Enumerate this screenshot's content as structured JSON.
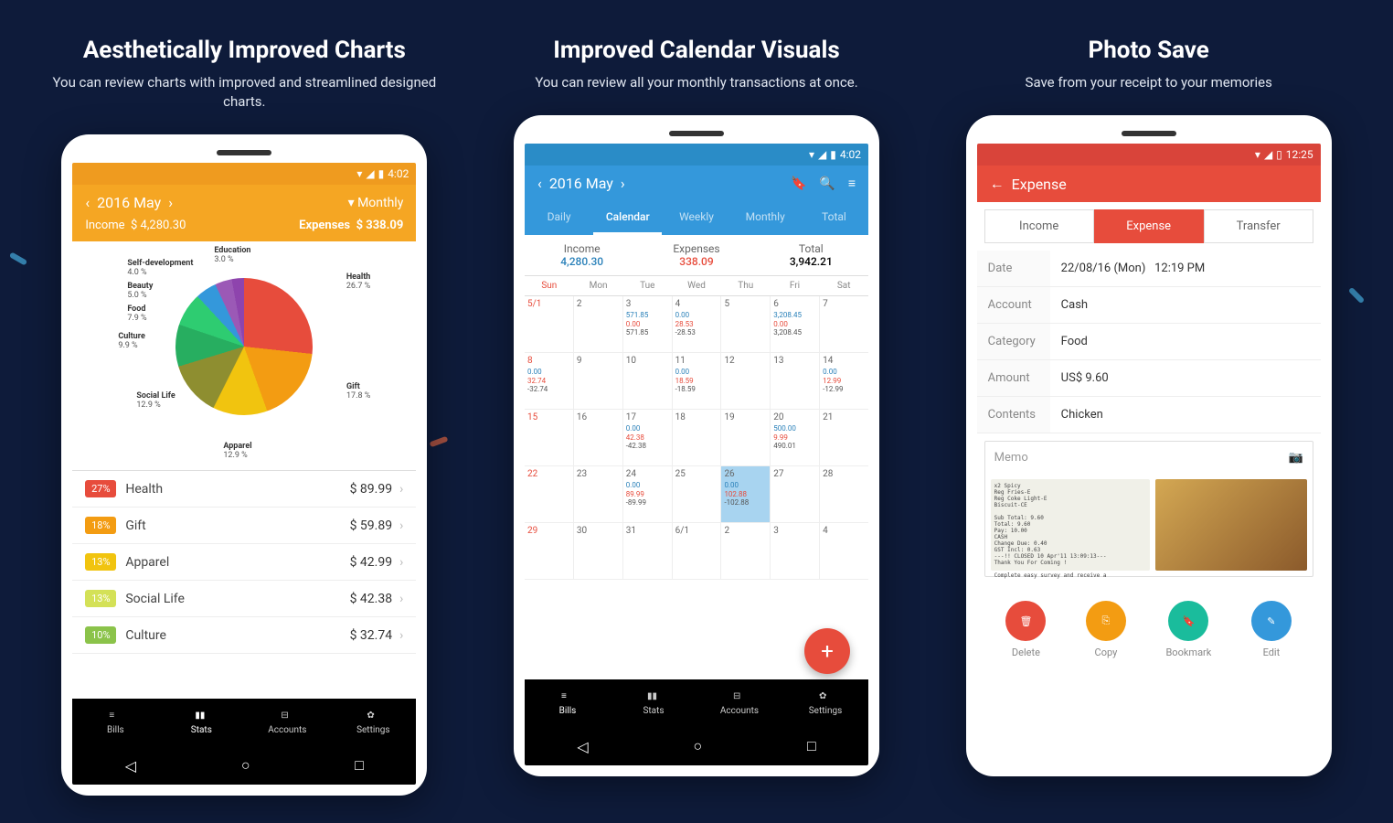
{
  "panels": {
    "charts": {
      "title": "Aesthetically Improved Charts",
      "subtitle": "You can review charts\nwith improved and streamlined designed charts."
    },
    "calendar": {
      "title": "Improved Calendar Visuals",
      "subtitle": "You can review all your monthly transactions at once."
    },
    "photo": {
      "title": "Photo Save",
      "subtitle": "Save from your receipt to your memories"
    }
  },
  "status": {
    "time": "4:02",
    "time_red": "12:25"
  },
  "header": {
    "month": "2016 May",
    "period": "Monthly",
    "income_label": "Income",
    "income_val": "$ 4,280.30",
    "expenses_label": "Expenses",
    "expenses_val": "$ 338.09",
    "expense_title": "Expense"
  },
  "tabs": {
    "daily": "Daily",
    "calendar": "Calendar",
    "weekly": "Weekly",
    "monthly": "Monthly",
    "total": "Total"
  },
  "summary": {
    "income_label": "Income",
    "income": "4,280.30",
    "expenses_label": "Expenses",
    "expenses": "338.09",
    "total_label": "Total",
    "total": "3,942.21"
  },
  "pie_labels": {
    "health": {
      "name": "Health",
      "pct": "26.7 %"
    },
    "gift": {
      "name": "Gift",
      "pct": "17.8 %"
    },
    "apparel": {
      "name": "Apparel",
      "pct": "12.9 %"
    },
    "social": {
      "name": "Social Life",
      "pct": "12.9 %"
    },
    "culture": {
      "name": "Culture",
      "pct": "9.9 %"
    },
    "food": {
      "name": "Food",
      "pct": "7.9 %"
    },
    "beauty": {
      "name": "Beauty",
      "pct": "5.0 %"
    },
    "selfdev": {
      "name": "Self-development",
      "pct": "4.0 %"
    },
    "education": {
      "name": "Education",
      "pct": "3.0 %"
    }
  },
  "chart_data": {
    "type": "pie",
    "title": "Expenses by Category",
    "series": [
      {
        "name": "Health",
        "value": 26.7,
        "amount": 89.99,
        "color": "#e74c3c"
      },
      {
        "name": "Gift",
        "value": 17.8,
        "amount": 59.89,
        "color": "#f39c12"
      },
      {
        "name": "Apparel",
        "value": 12.9,
        "amount": 42.99,
        "color": "#f1c40f"
      },
      {
        "name": "Social Life",
        "value": 12.9,
        "amount": 42.38,
        "color": "#8e8e30"
      },
      {
        "name": "Culture",
        "value": 9.9,
        "amount": 32.74,
        "color": "#27ae60"
      },
      {
        "name": "Food",
        "value": 7.9,
        "color": "#2ecc71"
      },
      {
        "name": "Beauty",
        "value": 5.0,
        "color": "#3498db"
      },
      {
        "name": "Self-development",
        "value": 4.0,
        "color": "#9b59b6"
      },
      {
        "name": "Education",
        "value": 3.0,
        "color": "#8e44ad"
      }
    ]
  },
  "expense_list": [
    {
      "pct": "27%",
      "name": "Health",
      "amount": "$ 89.99",
      "color": "#e74c3c"
    },
    {
      "pct": "18%",
      "name": "Gift",
      "amount": "$ 59.89",
      "color": "#f39c12"
    },
    {
      "pct": "13%",
      "name": "Apparel",
      "amount": "$ 42.99",
      "color": "#f1c40f"
    },
    {
      "pct": "13%",
      "name": "Social Life",
      "amount": "$ 42.38",
      "color": "#d4e157"
    },
    {
      "pct": "10%",
      "name": "Culture",
      "amount": "$ 32.74",
      "color": "#8bc34a"
    }
  ],
  "nav": {
    "bills": "Bills",
    "stats": "Stats",
    "accounts": "Accounts",
    "settings": "Settings"
  },
  "cal_days": [
    "Sun",
    "Mon",
    "Tue",
    "Wed",
    "Thu",
    "Fri",
    "Sat"
  ],
  "calendar": [
    [
      {
        "d": "5/1",
        "red": true
      },
      {
        "d": "2"
      },
      {
        "d": "3",
        "inc": "571.85",
        "exp": "0.00",
        "tot": "571.85"
      },
      {
        "d": "4",
        "inc": "0.00",
        "exp": "28.53",
        "tot": "-28.53"
      },
      {
        "d": "5"
      },
      {
        "d": "6",
        "inc": "3,208.45",
        "exp": "0.00",
        "tot": "3,208.45"
      },
      {
        "d": "7"
      }
    ],
    [
      {
        "d": "8",
        "red": true,
        "inc": "0.00",
        "exp": "32.74",
        "tot": "-32.74"
      },
      {
        "d": "9"
      },
      {
        "d": "10"
      },
      {
        "d": "11",
        "inc": "0.00",
        "exp": "18.59",
        "tot": "-18.59"
      },
      {
        "d": "12"
      },
      {
        "d": "13"
      },
      {
        "d": "14",
        "inc": "0.00",
        "exp": "12.99",
        "tot": "-12.99"
      }
    ],
    [
      {
        "d": "15",
        "red": true
      },
      {
        "d": "16"
      },
      {
        "d": "17",
        "inc": "0.00",
        "exp": "42.38",
        "tot": "-42.38"
      },
      {
        "d": "18"
      },
      {
        "d": "19"
      },
      {
        "d": "20",
        "inc": "500.00",
        "exp": "9.99",
        "tot": "490.01"
      },
      {
        "d": "21"
      }
    ],
    [
      {
        "d": "22",
        "red": true
      },
      {
        "d": "23"
      },
      {
        "d": "24",
        "inc": "0.00",
        "exp": "89.99",
        "tot": "-89.99"
      },
      {
        "d": "25"
      },
      {
        "d": "26",
        "today": true,
        "inc": "0.00",
        "exp": "102.88",
        "tot": "-102.88"
      },
      {
        "d": "27"
      },
      {
        "d": "28"
      }
    ],
    [
      {
        "d": "29",
        "red": true
      },
      {
        "d": "30"
      },
      {
        "d": "31"
      },
      {
        "d": "6/1"
      },
      {
        "d": "2"
      },
      {
        "d": "3"
      },
      {
        "d": "4"
      }
    ]
  ],
  "expense_form": {
    "tabs": {
      "income": "Income",
      "expense": "Expense",
      "transfer": "Transfer"
    },
    "date_label": "Date",
    "date": "22/08/16 (Mon)",
    "time": "12:19 PM",
    "account_label": "Account",
    "account": "Cash",
    "category_label": "Category",
    "category": "Food",
    "amount_label": "Amount",
    "amount": "US$ 9.60",
    "contents_label": "Contents",
    "contents": "Chicken",
    "memo": "Memo"
  },
  "actions": {
    "delete": "Delete",
    "copy": "Copy",
    "bookmark": "Bookmark",
    "edit": "Edit"
  },
  "receipt_text": "x2 Spicy\nReg Fries-E\nReg Coke Light-E\nBiscuit-CE\n\nSub Total:       9.60\nTotal:           9.60\nPay:            10.00\nCASH\nChange Due:      0.40\nGST Incl:        0.63\n---!! CLOSED 10 Apr'11 13:09:13---\n     Thank You For Coming !\n\nComplete easy survey and receive a"
}
